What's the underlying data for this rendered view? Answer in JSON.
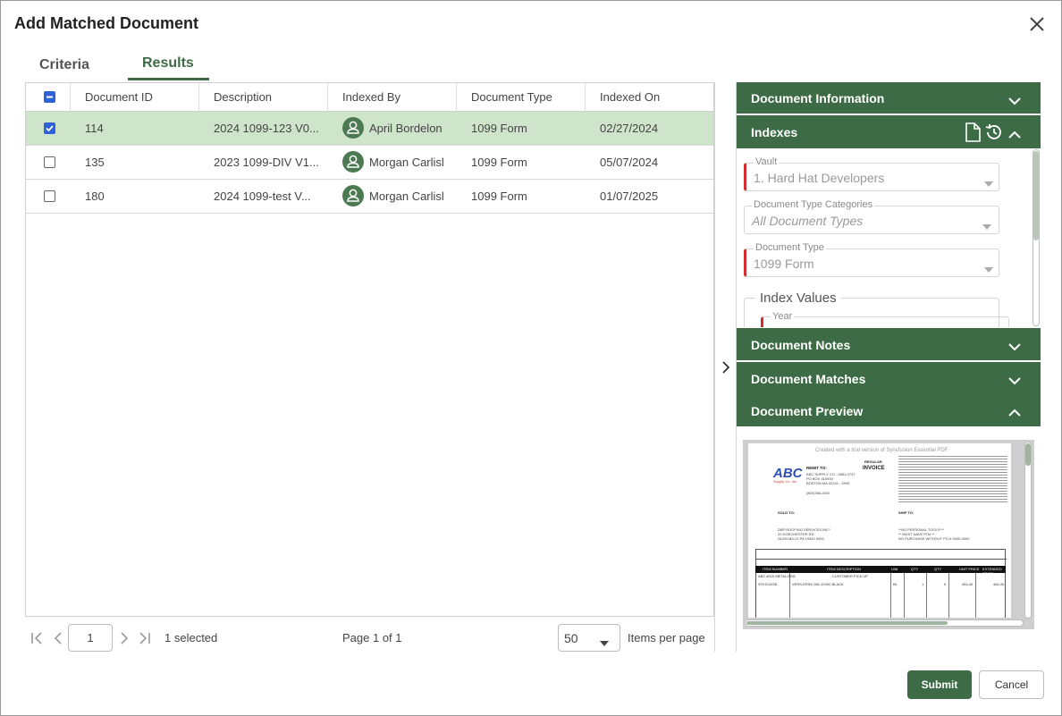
{
  "dialog": {
    "title": "Add Matched Document"
  },
  "tabs": [
    {
      "label": "Criteria"
    },
    {
      "label": "Results"
    }
  ],
  "grid": {
    "columns": [
      "Document ID",
      "Description",
      "Indexed By",
      "Document Type",
      "Indexed On"
    ],
    "rows": [
      {
        "id": "114",
        "description": "2024 1099-123 V0...",
        "indexed_by": "April Bordelon",
        "doc_type": "1099 Form",
        "indexed_on": "02/27/2024",
        "selected": true
      },
      {
        "id": "135",
        "description": "2023 1099-DIV V1...",
        "indexed_by": "Morgan Carlisl",
        "doc_type": "1099 Form",
        "indexed_on": "05/07/2024",
        "selected": false
      },
      {
        "id": "180",
        "description": "2024 1099-test V...",
        "indexed_by": "Morgan Carlisl",
        "doc_type": "1099 Form",
        "indexed_on": "01/07/2025",
        "selected": false
      }
    ]
  },
  "pager": {
    "current_page": "1",
    "selected_text": "1 selected",
    "page_info": "Page 1 of 1",
    "page_size": "50",
    "items_per_page_label": "Items per page"
  },
  "panel": {
    "document_information": "Document Information",
    "indexes": "Indexes",
    "fields": {
      "vault_label": "Vault",
      "vault_value": "1. Hard Hat Developers",
      "categories_label": "Document Type Categories",
      "categories_value": "All Document Types",
      "doc_type_label": "Document Type",
      "doc_type_value": "1099 Form",
      "index_values_label": "Index Values",
      "year_label": "Year"
    },
    "document_notes": "Document Notes",
    "document_matches": "Document Matches",
    "document_preview": "Document Preview"
  },
  "preview": {
    "watermark": "Created with a trial version of Syncfusion Essential PDF",
    "logo_text": "ABC",
    "logo_sub": "Supply Co. Inc.",
    "remit_to": "REMIT TO:",
    "remit_lines": [
      "ABC SUPPLY CO - 0881-0737",
      "PO BOX 415930",
      "BOSTON MA 02241 - 5930"
    ],
    "phone": "(800)366-2002",
    "regular": "REGULAR",
    "invoice": "INVOICE",
    "sold_to": "SOLD TO:",
    "ship_to": "SHIP TO:",
    "sold_lines": [
      "DBP ROOFING SERVICES INC*",
      "20 DORCHESTER RD",
      "GLEN MILLS PA 19342 0000"
    ],
    "ship_lines": [
      "**NO PERSONAL TOOLS***",
      "** MUST HAVE PO# **",
      "NO PURCHASE WITHOUT PO # 0000-0000"
    ],
    "table_headers": [
      "ITEM NUMBER",
      "ITEM DESCRIPTION",
      "U/M",
      "QTY",
      "QTY",
      "UNIT PRICE",
      "EXTENDED PRICE"
    ],
    "table_row": [
      "ABC #010 METAL/DEB",
      "CUSTOMER PICK UP"
    ],
    "line_item": [
      "STKG10GB",
      "VERS-ERSK 060 10X50 BLACK",
      "BL",
      "1",
      "0",
      "464.40",
      "464.40"
    ]
  },
  "buttons": {
    "submit": "Submit",
    "cancel": "Cancel"
  },
  "colors": {
    "accent": "#3c6b45",
    "selected_row": "#cfe5cb",
    "checkbox": "#2f62d8",
    "required": "#d32f2f"
  }
}
